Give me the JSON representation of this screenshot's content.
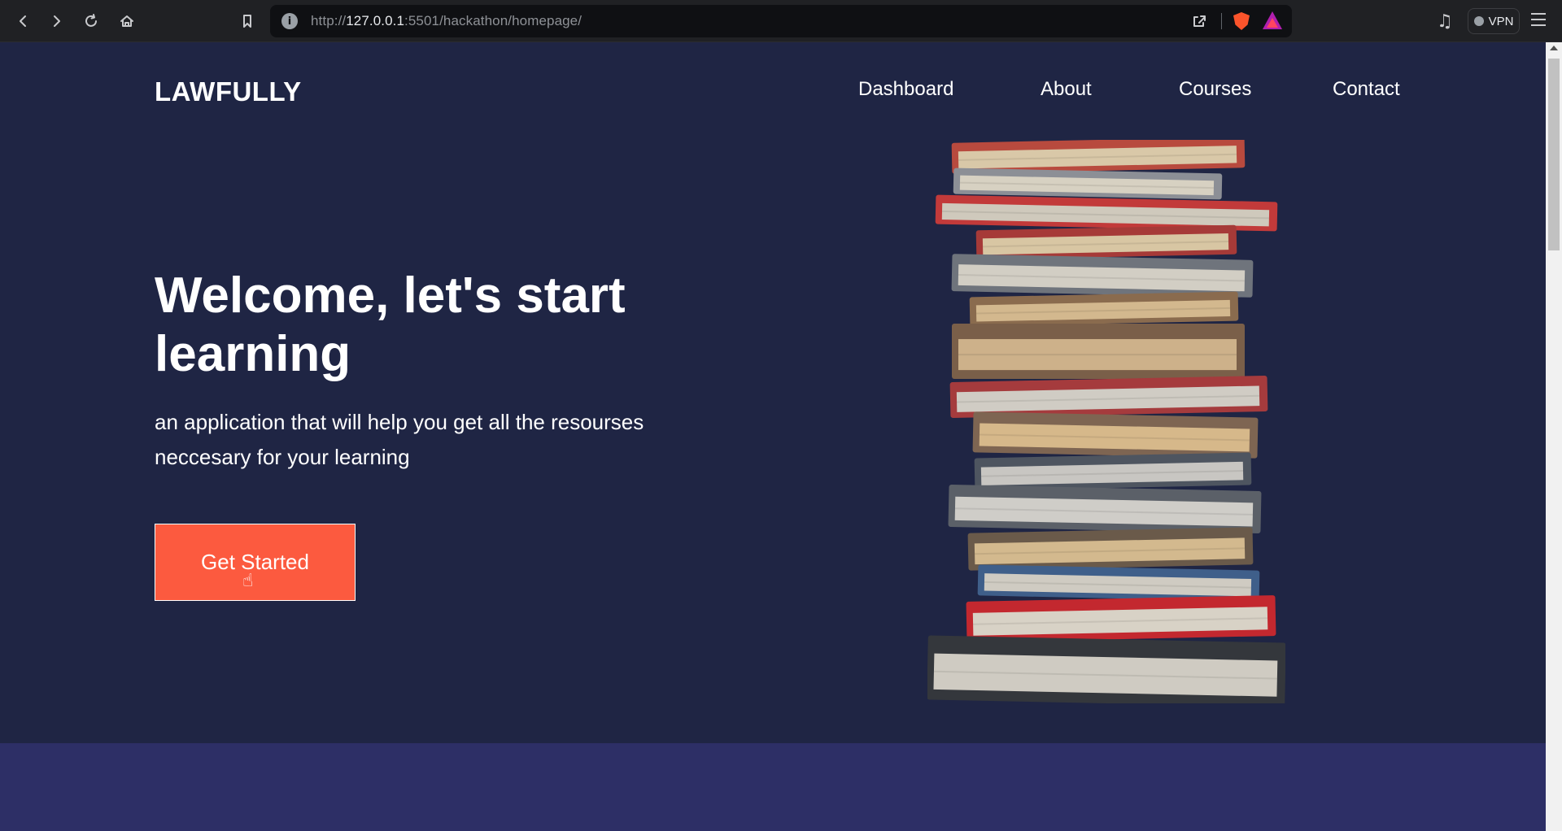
{
  "browser": {
    "url_scheme": "http://",
    "url_host": "127.0.0.1",
    "url_rest": ":5501/hackathon/homepage/",
    "vpn_label": "VPN"
  },
  "header": {
    "brand": "LAWFULLY",
    "nav": [
      "Dashboard",
      "About",
      "Courses",
      "Contact"
    ]
  },
  "hero": {
    "title": "Welcome, let's start learning",
    "subtitle": "an application that will help you get all the resourses neccesary for your learning",
    "cta_label": "Get Started"
  },
  "colors": {
    "page_bg": "#1f2544",
    "cta_bg": "#fc5a3f",
    "lower_section_bg": "#2d2f66"
  }
}
